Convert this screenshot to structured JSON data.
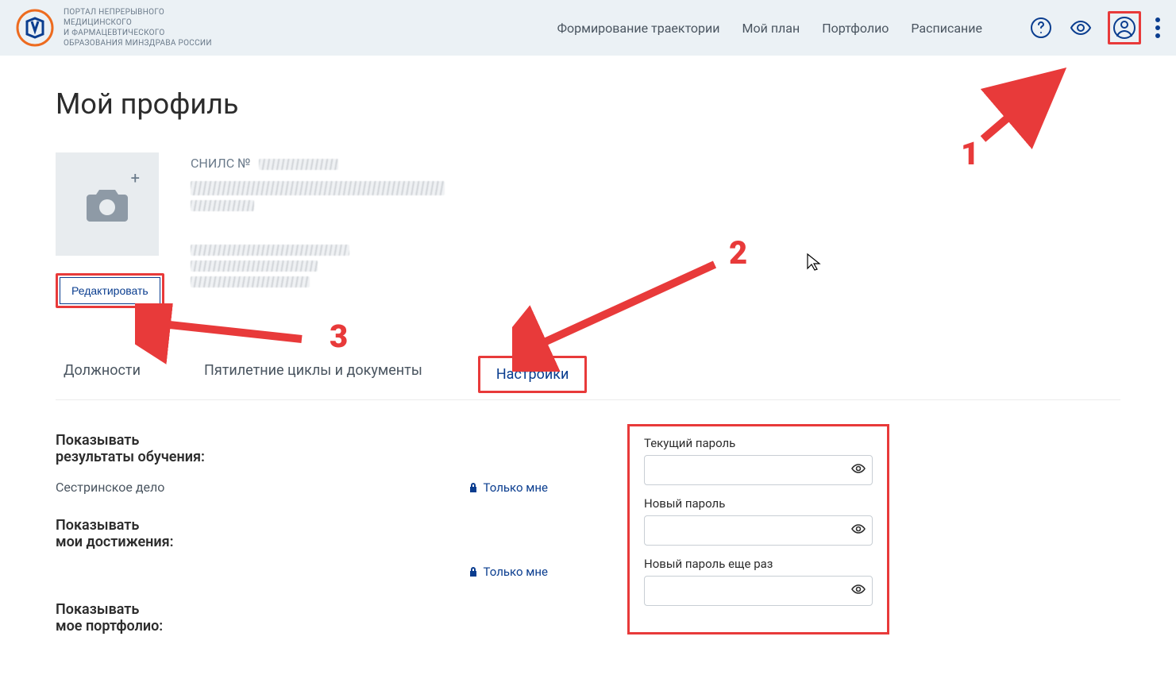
{
  "header": {
    "logo_text_line1": "ПОРТАЛ НЕПРЕРЫВНОГО",
    "logo_text_line2": "МЕДИЦИНСКОГО",
    "logo_text_line3": "И ФАРМАЦЕВТИЧЕСКОГО",
    "logo_text_line4": "ОБРАЗОВАНИЯ МИНЗДРАВА РОССИИ",
    "nav": {
      "trajectory": "Формирование траектории",
      "plan": "Мой план",
      "portfolio": "Портфолио",
      "schedule": "Расписание"
    }
  },
  "page": {
    "title": "Мой профиль",
    "snils_label": "СНИЛС №",
    "edit_button": "Редактировать"
  },
  "tabs": {
    "positions": "Должности",
    "cycles": "Пятилетние циклы и документы",
    "settings": "Настройки"
  },
  "settings": {
    "show_results_label_1": "Показывать",
    "show_results_label_2": "результаты обучения:",
    "specialty_1": "Сестринское дело",
    "privacy_only_me": "Только мне",
    "show_achievements_label_1": "Показывать",
    "show_achievements_label_2": "мои достижения:",
    "show_portfolio_label_1": "Показывать",
    "show_portfolio_label_2": "мое портфолио:"
  },
  "password": {
    "current_label": "Текущий пароль",
    "new_label": "Новый пароль",
    "repeat_label": "Новый пароль еще раз"
  },
  "annotations": {
    "n1": "1",
    "n2": "2",
    "n3": "3"
  }
}
